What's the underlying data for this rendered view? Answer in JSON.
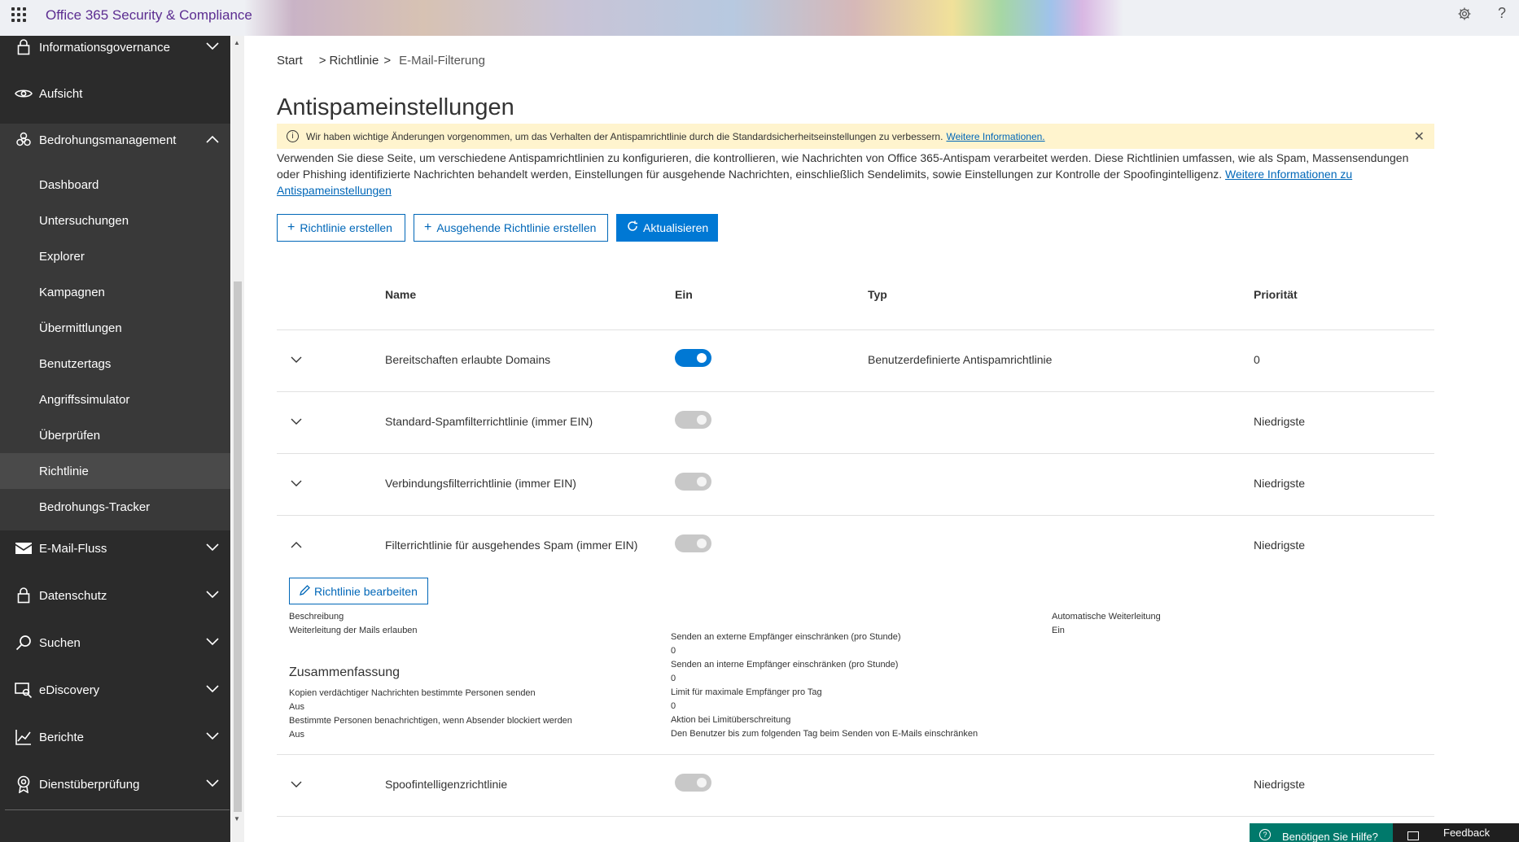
{
  "app": {
    "title": "Office 365 Security & Compliance"
  },
  "sidebar": {
    "top_items": [
      {
        "label": "Informationsgovernance",
        "icon": "lock-icon"
      },
      {
        "label": "Aufsicht",
        "icon": "eye-icon"
      },
      {
        "label": "Bedrohungsmanagement",
        "icon": "biohazard-icon"
      }
    ],
    "sub_items": [
      {
        "label": "Dashboard"
      },
      {
        "label": "Untersuchungen"
      },
      {
        "label": "Explorer"
      },
      {
        "label": "Kampagnen"
      },
      {
        "label": "Übermittlungen"
      },
      {
        "label": "Benutzertags"
      },
      {
        "label": "Angriffssimulator"
      },
      {
        "label": "Überprüfen"
      },
      {
        "label": "Richtlinie"
      },
      {
        "label": "Bedrohungs-Tracker"
      }
    ],
    "bottom_items": [
      {
        "label": "E-Mail-Fluss",
        "icon": "mail-icon"
      },
      {
        "label": "Datenschutz",
        "icon": "lock-icon"
      },
      {
        "label": "Suchen",
        "icon": "search-icon"
      },
      {
        "label": "eDiscovery",
        "icon": "ediscovery-icon"
      },
      {
        "label": "Berichte",
        "icon": "chart-icon"
      },
      {
        "label": "Dienstüberprüfung",
        "icon": "ribbon-icon"
      }
    ],
    "active_item": "Richtlinie"
  },
  "breadcrumb": {
    "items": [
      "Start",
      "Richtlinie",
      "E-Mail-Filterung"
    ],
    "sep1": ">",
    "sep2": ">"
  },
  "page": {
    "title": "Antispameinstellungen",
    "banner_text": "Wir haben wichtige Änderungen vorgenommen, um das Verhalten der Antispamrichtlinie durch die Standardsicherheitseinstellungen zu verbessern.",
    "banner_link": "Weitere Informationen.",
    "description": "Verwenden Sie diese Seite, um verschiedene Antispamrichtlinien zu konfigurieren, die kontrollieren, wie Nachrichten von Office 365-Antispam verarbeitet werden. Diese Richtlinien umfassen, wie als Spam, Massensendungen oder Phishing identifizierte Nachrichten behandelt werden, Einstellungen für ausgehende Nachrichten, einschließlich Sendelimits, sowie Einstellungen zur Kontrolle der Spoofingintelligenz.",
    "description_link": "Weitere Informationen zu Antispameinstellungen"
  },
  "toolbar": {
    "create_policy": "Richtlinie erstellen",
    "create_outbound_policy": "Ausgehende Richtlinie erstellen",
    "refresh": "Aktualisieren"
  },
  "table": {
    "headers": {
      "name": "Name",
      "on": "Ein",
      "type": "Typ",
      "priority": "Priorität"
    },
    "rows": [
      {
        "name": "Bereitschaften erlaubte Domains",
        "enabled": true,
        "type": "Benutzerdefinierte Antispamrichtlinie",
        "priority": "0"
      },
      {
        "name": "Standard-Spamfilterrichtlinie (immer EIN)",
        "enabled": false,
        "type": "",
        "priority": "Niedrigste"
      },
      {
        "name": "Verbindungsfilterrichtlinie (immer EIN)",
        "enabled": false,
        "type": "",
        "priority": "Niedrigste"
      },
      {
        "name": "Filterrichtlinie für ausgehendes Spam (immer EIN)",
        "enabled": false,
        "type": "",
        "priority": "Niedrigste",
        "expanded": true
      },
      {
        "name": "Spoofintelligenzrichtlinie",
        "enabled": false,
        "type": "",
        "priority": "Niedrigste"
      }
    ]
  },
  "details": {
    "edit_button": "Richtlinie bearbeiten",
    "description_label": "Beschreibung",
    "description_value": "Weiterleitung der Mails erlauben",
    "summary_heading": "Zusammenfassung",
    "copy_label": "Kopien verdächtiger Nachrichten bestimmte Personen senden",
    "copy_value": "Aus",
    "notify_label": "Bestimmte Personen benachrichtigen, wenn Absender blockiert werden",
    "notify_value": "Aus",
    "ext_limit_label": "Senden an externe Empfänger einschränken (pro Stunde)",
    "ext_limit_value": "0",
    "int_limit_label": "Senden an interne Empfänger einschränken (pro Stunde)",
    "int_limit_value": "0",
    "daily_limit_label": "Limit für maximale Empfänger pro Tag",
    "daily_limit_value": "0",
    "action_label": "Aktion bei Limitüberschreitung",
    "action_value": "Den Benutzer bis zum folgenden Tag beim Senden von E-Mails einschränken",
    "auto_forward_label": "Automatische Weiterleitung",
    "auto_forward_value": "Ein"
  },
  "footer": {
    "help": "Benötigen Sie Hilfe?",
    "feedback": "Feedback"
  },
  "colors": {
    "brand": "#5c2d91",
    "accent": "#0078d4",
    "sidebar_bg": "#2b2b2b",
    "banner_bg": "#fff4ce",
    "help_bg": "#00796b"
  }
}
